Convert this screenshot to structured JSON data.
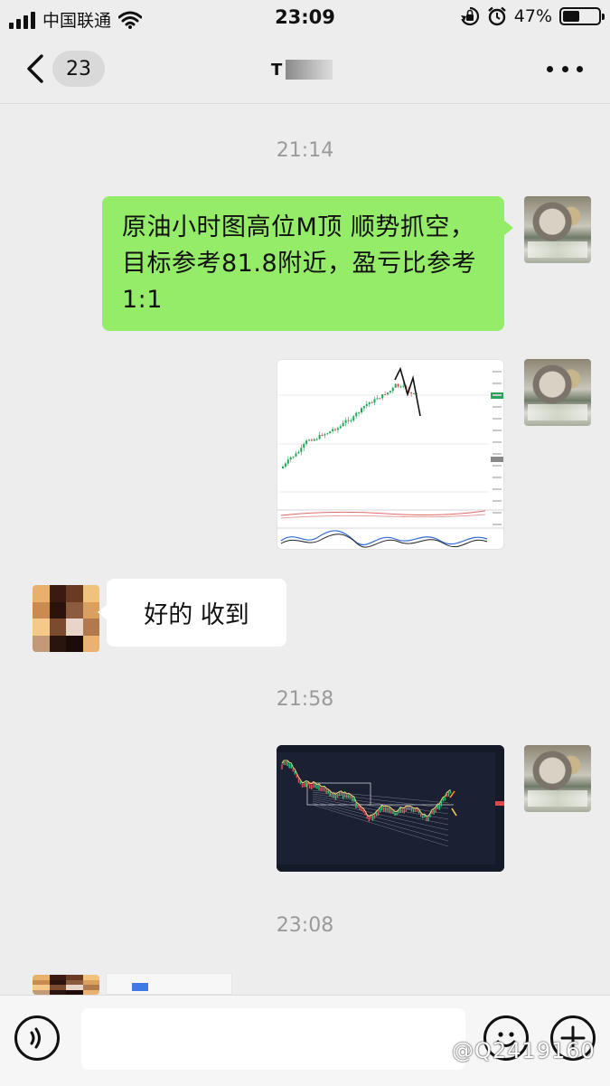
{
  "status_bar": {
    "carrier": "中国联通",
    "time": "23:09",
    "battery": "47%",
    "battery_level": 0.47
  },
  "nav": {
    "unread_count": "23",
    "title_initial": "T"
  },
  "messages": {
    "ts1": "21:14",
    "text_out": "原油小时图高位M顶 顺势抓空，目标参考81.8附近，盈亏比参考1:1",
    "text_in": "好的 收到",
    "ts2": "21:58",
    "ts3": "23:08"
  },
  "watermark": "@Q2419160",
  "colors": {
    "bubble_out": "#95ec69",
    "bubble_in": "#ffffff",
    "background": "#ededed",
    "chart_dark_bg": "#1b2133"
  },
  "icons": [
    "wifi-icon",
    "lock-rotation-icon",
    "alarm-icon",
    "back-chevron-icon",
    "more-dots-icon",
    "voice-icon",
    "emoji-icon",
    "plus-icon"
  ]
}
